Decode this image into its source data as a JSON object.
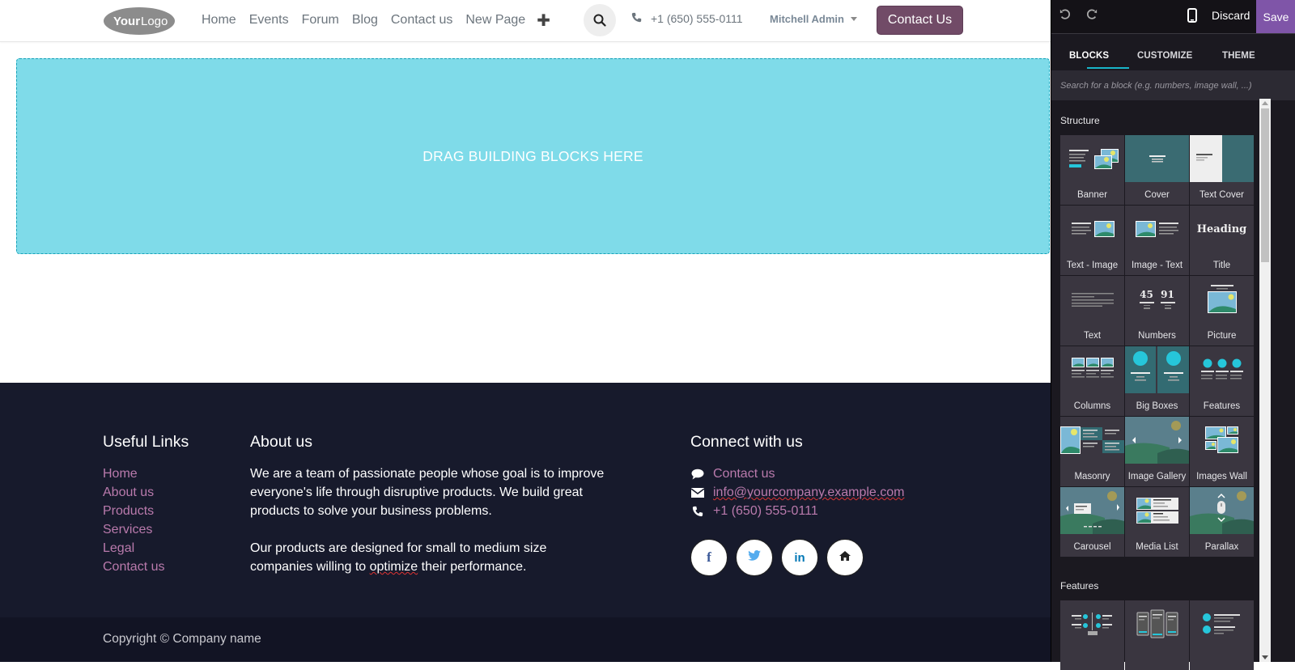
{
  "header": {
    "logo_text_bold": "Your",
    "logo_text_light": "Logo",
    "nav": [
      "Home",
      "Events",
      "Forum",
      "Blog",
      "Contact us",
      "New Page"
    ],
    "add_page_icon": "plus-icon",
    "search_icon": "search-icon",
    "phone": "+1 (650) 555-0111",
    "user": "Mitchell Admin",
    "cta_label": "Contact Us"
  },
  "dropzone": {
    "text": "DRAG BUILDING BLOCKS HERE"
  },
  "footer": {
    "useful_links": {
      "title": "Useful Links",
      "items": [
        "Home",
        "About us",
        "Products",
        "Services",
        "Legal",
        "Contact us"
      ]
    },
    "about": {
      "title": "About us",
      "paragraph1": "We are a team of passionate people whose goal is to improve everyone's life through disruptive products. We build great products to solve your business problems.",
      "paragraph2_before": "Our products are designed for small to medium size companies willing to ",
      "paragraph2_misspelled": "optimize",
      "paragraph2_after": " their performance."
    },
    "connect": {
      "title": "Connect with us",
      "items": [
        {
          "icon": "comment-icon",
          "text": "Contact us"
        },
        {
          "icon": "envelope-icon",
          "text": "info@yourcompany.example.com"
        },
        {
          "icon": "phone-icon",
          "text": "+1 (650) 555-0111"
        }
      ],
      "socials": [
        {
          "name": "facebook",
          "glyph": "f",
          "color": "#3b5998"
        },
        {
          "name": "twitter",
          "glyph": "t",
          "color": "#55acee"
        },
        {
          "name": "linkedin",
          "glyph": "in",
          "color": "#0077b5"
        },
        {
          "name": "home",
          "glyph": "⌂",
          "color": "#222222"
        }
      ]
    },
    "copyright": "Copyright © Company name"
  },
  "editor": {
    "discard_label": "Discard",
    "save_label": "Save",
    "tabs": [
      "BLOCKS",
      "CUSTOMIZE",
      "THEME"
    ],
    "active_tab": "BLOCKS",
    "search_placeholder": "Search for a block (e.g. numbers, image wall, ...)",
    "sections": [
      {
        "title": "Structure",
        "blocks": [
          "Banner",
          "Cover",
          "Text Cover",
          "Text - Image",
          "Image - Text",
          "Title",
          "Text",
          "Numbers",
          "Picture",
          "Columns",
          "Big Boxes",
          "Features",
          "Masonry",
          "Image Gallery",
          "Images Wall",
          "Carousel",
          "Media List",
          "Parallax"
        ]
      },
      {
        "title": "Features",
        "blocks": [
          "",
          "",
          ""
        ]
      }
    ],
    "numbers_thumb": [
      "45",
      "91"
    ],
    "title_thumb": "Heading",
    "accent_color": "#19b5c9",
    "save_color": "#7f55a8"
  },
  "colors": {
    "brand": "#714b67",
    "dropzone": "#7fdbe9",
    "footer_bg": "#171a2c",
    "link": "#b97aac"
  }
}
